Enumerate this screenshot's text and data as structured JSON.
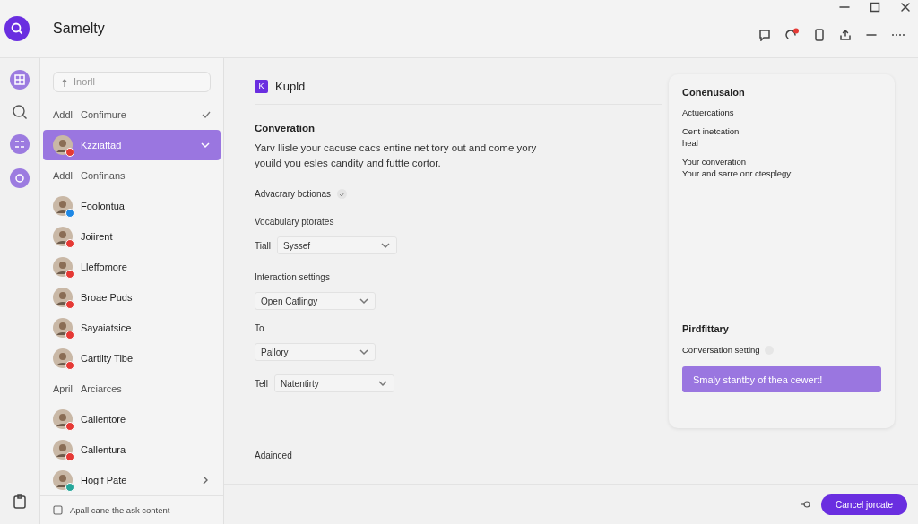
{
  "window": {
    "title": "Samelty"
  },
  "sidebar": {
    "search": {
      "placeholder": "Inorll"
    },
    "items": [
      {
        "kind": "section",
        "prefix": "Addl",
        "label": "Confimure",
        "checked": true
      },
      {
        "kind": "contact",
        "name": "Kzziaftad",
        "selected": true,
        "expanded": true,
        "color": "#e53935"
      },
      {
        "kind": "section",
        "prefix": "Addl",
        "label": "Confinans",
        "checked": false
      },
      {
        "kind": "contact",
        "name": "Foolontua",
        "selected": false,
        "color": "#1e88e5"
      },
      {
        "kind": "contact",
        "name": "Joiirent",
        "selected": false,
        "color": "#e53935"
      },
      {
        "kind": "contact",
        "name": "Lleffomore",
        "selected": false,
        "color": "#e53935"
      },
      {
        "kind": "contact",
        "name": "Broae Puds",
        "selected": false,
        "color": "#e53935"
      },
      {
        "kind": "contact",
        "name": "Sayaiatsice",
        "selected": false,
        "color": "#e53935"
      },
      {
        "kind": "contact",
        "name": "Cartilty Tibe",
        "selected": false,
        "color": "#e53935"
      },
      {
        "kind": "section",
        "prefix": "April",
        "label": "Arciarces",
        "checked": false
      },
      {
        "kind": "contact",
        "name": "Callentore",
        "selected": false,
        "color": "#e53935"
      },
      {
        "kind": "contact",
        "name": "Callentura",
        "selected": false,
        "color": "#e53935"
      },
      {
        "kind": "contact",
        "name": "Hoglf Pate",
        "selected": false,
        "expanded": false,
        "color": "#26a69a"
      }
    ],
    "footer": "Apall cane the ask content"
  },
  "main": {
    "badge": "K",
    "title": "Kupld",
    "heading": "Converation",
    "description": "Yarv llisle your cacuse cacs entine net tory out and come yory youild you esles candity and futtte cortor.",
    "fields": [
      {
        "kind": "check",
        "label": "Advacrary bctionas",
        "checked": true
      },
      {
        "kind": "label",
        "text": "Vocabulary ptorates"
      },
      {
        "kind": "select",
        "label": "Tiall",
        "value": "Syssef"
      },
      {
        "kind": "label",
        "text": "Interaction settings"
      },
      {
        "kind": "select",
        "value": "Open Catlingy"
      },
      {
        "kind": "label",
        "text": "To"
      },
      {
        "kind": "select",
        "value": "Pallory"
      },
      {
        "kind": "select",
        "label": "Tell",
        "value": "Natentirty"
      },
      {
        "kind": "label",
        "text": "Adainced"
      }
    ]
  },
  "card": {
    "title": "Conenusaion",
    "lines": [
      "Actuercations",
      "Cent inetcation",
      "heal",
      "Your converation",
      "Your and sarre onr ctesplegy:"
    ],
    "subtitle": "Pirdfittary",
    "setting": "Conversation setting",
    "action": "Smaly stantby of thea cewert!"
  },
  "footer": {
    "button": "Cancel jorcate"
  }
}
